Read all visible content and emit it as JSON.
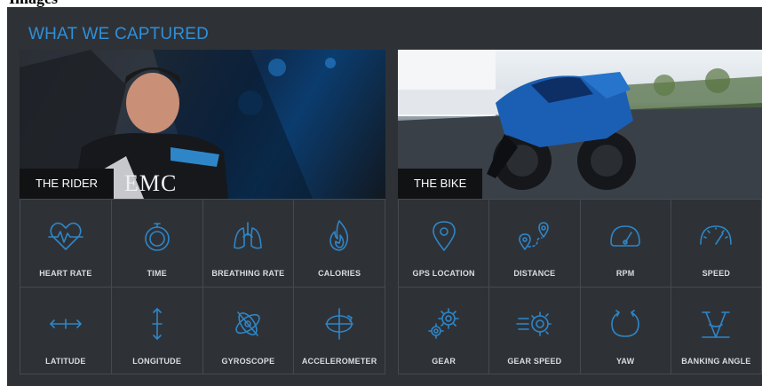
{
  "header_fragment": "Images",
  "title": "WHAT WE CAPTURED",
  "rider": {
    "label": "THE RIDER",
    "jersey_text": "EMC",
    "metrics": [
      {
        "label": "HEART RATE",
        "icon": "heart-rate-icon"
      },
      {
        "label": "TIME",
        "icon": "stopwatch-icon"
      },
      {
        "label": "BREATHING RATE",
        "icon": "lungs-icon"
      },
      {
        "label": "CALORIES",
        "icon": "flame-icon"
      },
      {
        "label": "LATITUDE",
        "icon": "latitude-icon"
      },
      {
        "label": "LONGITUDE",
        "icon": "longitude-icon"
      },
      {
        "label": "GYROSCOPE",
        "icon": "gyroscope-icon"
      },
      {
        "label": "ACCELEROMETER",
        "icon": "accelerometer-icon"
      }
    ]
  },
  "bike": {
    "label": "THE BIKE",
    "metrics": [
      {
        "label": "GPS LOCATION",
        "icon": "map-pin-icon"
      },
      {
        "label": "DISTANCE",
        "icon": "distance-icon"
      },
      {
        "label": "RPM",
        "icon": "rpm-gauge-icon"
      },
      {
        "label": "SPEED",
        "icon": "speedometer-icon"
      },
      {
        "label": "GEAR",
        "icon": "gears-icon"
      },
      {
        "label": "GEAR SPEED",
        "icon": "gear-speed-icon"
      },
      {
        "label": "YAW",
        "icon": "yaw-icon"
      },
      {
        "label": "BANKING ANGLE",
        "icon": "banking-angle-icon"
      }
    ]
  },
  "colors": {
    "accent": "#2e86c8",
    "title": "#2f8fd8",
    "panel_bg": "#2e3237",
    "label_bg": "#111214"
  }
}
